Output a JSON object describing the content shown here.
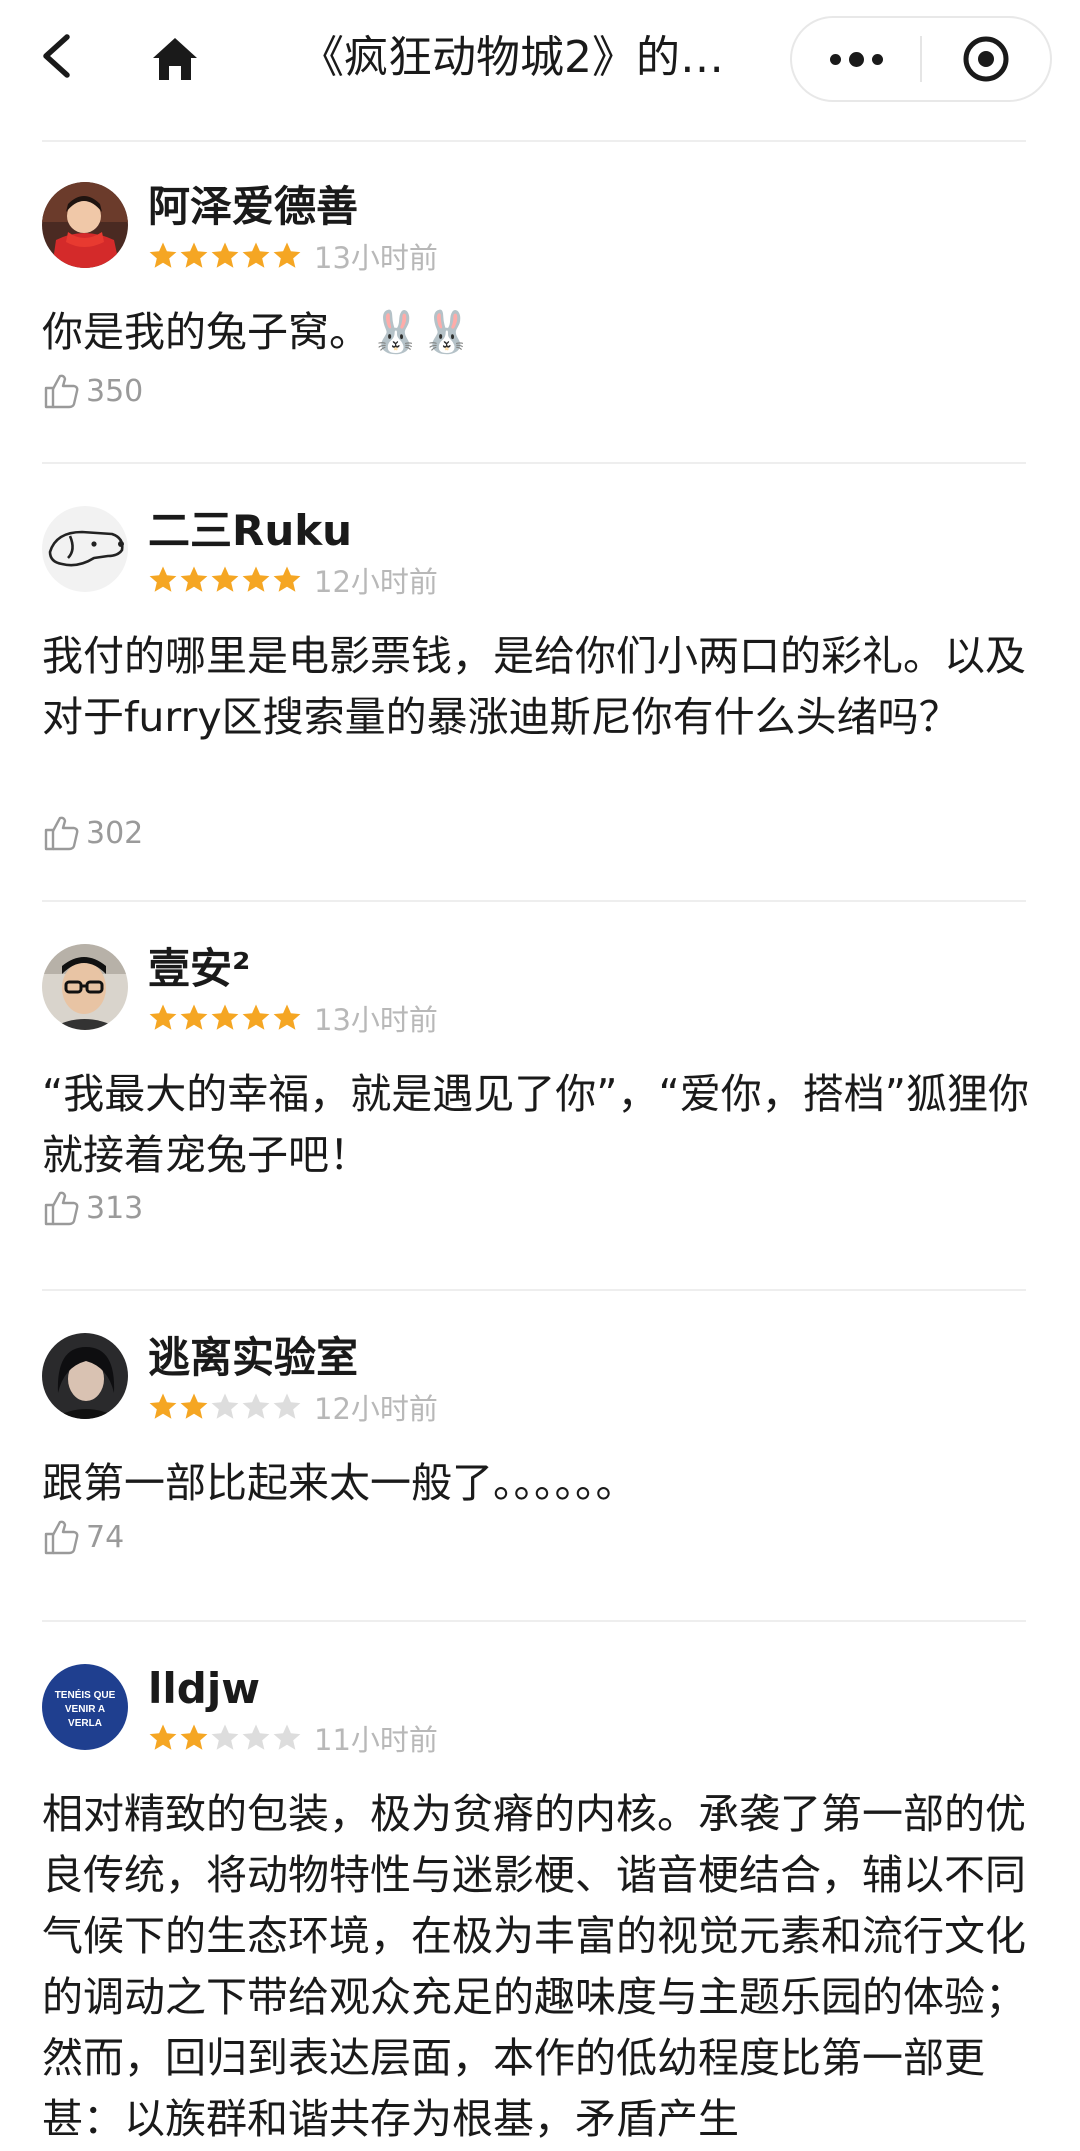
{
  "nav": {
    "title": "《疯狂动物城2》的…",
    "back_icon": "back-arrow-icon",
    "home_icon": "home-icon",
    "more_icon": "more-dots-icon",
    "close_icon": "target-close-icon"
  },
  "colors": {
    "star_on": "#F5A623",
    "star_off": "#DDDDDD",
    "meta_text": "#B8B8B8",
    "like_text": "#9A9A9A"
  },
  "comments": [
    {
      "username": "阿泽爱德善",
      "rating": 5,
      "time": "13小时前",
      "content": "你是我的兔子窝。🐰🐰",
      "likes": "350",
      "avatar": "photo-avatar-red-scarf"
    },
    {
      "username": "二三Ruku",
      "rating": 5,
      "time": "12小时前",
      "content": "我付的哪里是电影票钱，是给你们小两口的彩礼。以及对于furry区搜索量的暴涨迪斯尼你有什么头绪吗？",
      "likes": "302",
      "avatar": "dog-sketch-avatar"
    },
    {
      "username": "壹安²",
      "rating": 5,
      "time": "13小时前",
      "content": "“我最大的幸福，就是遇见了你”，“爱你，搭档”狐狸你就接着宠兔子吧！",
      "likes": "313",
      "avatar": "photo-avatar-glasses"
    },
    {
      "username": "逃离实验室",
      "rating": 2,
      "time": "12小时前",
      "content": "跟第一部比起来太一般了。。。。。。",
      "likes": "74",
      "avatar": "photo-avatar-dark"
    },
    {
      "username": "lldjw",
      "rating": 2,
      "time": "11小时前",
      "content": "相对精致的包装，极为贫瘠的内核。承袭了第一部的优良传统，将动物特性与迷影梗、谐音梗结合，辅以不同气候下的生态环境，在极为丰富的视觉元素和流行文化的调动之下带给观众充足的趣味度与主题乐园的体验；然而，回归到表达层面，本作的低幼程度比第一部更甚：以族群和谐共存为根基，矛盾产生",
      "likes": "",
      "avatar": "blue-badge-avatar",
      "avatar_text": [
        "TENÉIS QUE",
        "VENIR A",
        "VERLA"
      ]
    }
  ]
}
